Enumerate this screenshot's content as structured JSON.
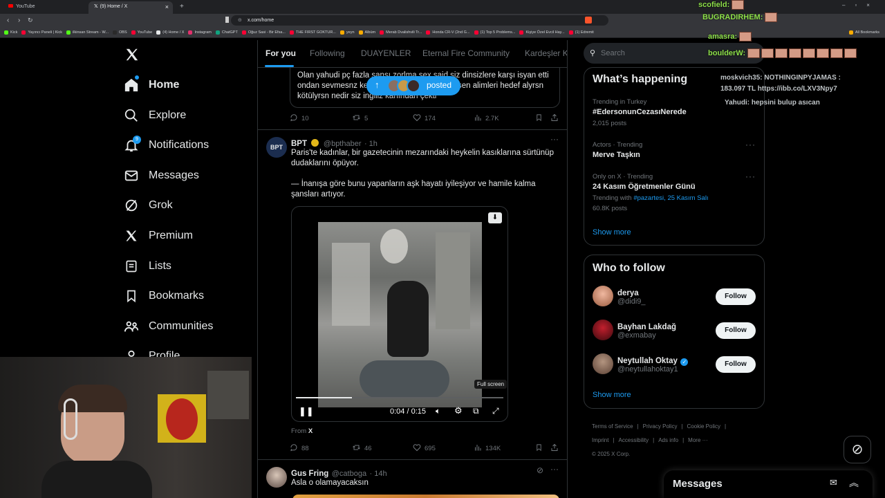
{
  "browser": {
    "tabs": [
      {
        "label": "YouTube"
      },
      {
        "label": "(9) Home / X"
      }
    ],
    "url": "x.com/home",
    "bookmarks": [
      "Kick",
      "Yayıncı Paneli | Kick",
      "ilkinsan Stream - W...",
      "OBS",
      "YouTube",
      "(4) Home / X",
      "Instagram",
      "ChatGPT",
      "Oğuz Sasi - Bir Efsa...",
      "THE FIRST GOKTUR...",
      "yeyn",
      "Albüm",
      "Merab Dvalishvili Tr...",
      "Honda CR-V (2nd G...",
      "(1) Top 5 Problems...",
      "Kişiye Özel Evcil Hay...",
      "(1) Edremit",
      "All Bookmarks"
    ]
  },
  "nav": {
    "items": [
      {
        "label": "Home",
        "icon": "home-icon"
      },
      {
        "label": "Explore",
        "icon": "search-icon"
      },
      {
        "label": "Notifications",
        "icon": "bell-icon",
        "badge": "9"
      },
      {
        "label": "Messages",
        "icon": "mail-icon"
      },
      {
        "label": "Grok",
        "icon": "grok-icon"
      },
      {
        "label": "Premium",
        "icon": "x-logo-icon"
      },
      {
        "label": "Lists",
        "icon": "list-icon"
      },
      {
        "label": "Bookmarks",
        "icon": "bookmark-icon"
      },
      {
        "label": "Communities",
        "icon": "people-icon"
      },
      {
        "label": "Profile",
        "icon": "person-icon"
      }
    ]
  },
  "feed": {
    "tabs": [
      "For you",
      "Following",
      "DUAYENLER",
      "Eternal Fire Community",
      "Kardeşler Ki"
    ],
    "posted_pill": "posted",
    "tweet1": {
      "text_lines": [
        "Olan yahudi pç fazla şansı zorlma sex said siz dinsizlere karşı isyan etti",
        "ondan sevmesnz ke",
        "sen alimleri hedef alyrsn",
        "kötülyrsn nedir siz ingiliz kanından çekti"
      ],
      "replies": "10",
      "reposts": "5",
      "likes": "174",
      "views": "2.7K"
    },
    "tweet2": {
      "avatar_text": "BPT",
      "name": "BPT",
      "handle": "@bpthaber",
      "time": "· 1h",
      "text1": "Paris'te kadınlar, bir gazetecinin mezarındaki heykelin kasıklarına sürtünüp dudaklarını öpüyor.",
      "text2": "— İnanışa göre bunu yapanların aşk hayatı iyileşiyor ve hamile kalma şansları artıyor.",
      "video_time": "0:04 / 0:15",
      "tooltip": "Full screen",
      "from_label": "From",
      "from_source": "X",
      "replies": "88",
      "reposts": "46",
      "likes": "695",
      "views": "134K",
      "video_progress": 0.27
    },
    "tweet3": {
      "name": "Gus Fring",
      "handle": "@catboga",
      "time": "· 14h",
      "text": "Asla o olamayacaksın"
    }
  },
  "sidebar": {
    "search_placeholder": "Search",
    "happening": {
      "title": "What’s happening",
      "trends": [
        {
          "meta": "Trending in Turkey",
          "name": "#EdersonunCezasıNerede",
          "count": "2,015 posts"
        },
        {
          "meta": "Actors · Trending",
          "name": "Merve Taşkın",
          "count": ""
        },
        {
          "meta": "Only on X · Trending",
          "name": "24 Kasım Öğretmenler Günü",
          "with_label": "Trending with",
          "with_tags": "#pazartesi, 25 Kasım Salı",
          "count": "60.8K posts"
        }
      ],
      "show_more": "Show more"
    },
    "who_to_follow": {
      "title": "Who to follow",
      "users": [
        {
          "name": "derya",
          "handle": "@didi9_",
          "button": "Follow",
          "verified": false
        },
        {
          "name": "Bayhan Lakdağ",
          "handle": "@exmabay",
          "button": "Follow",
          "verified": false
        },
        {
          "name": "Neytullah Oktay",
          "handle": "@neytullahoktay1",
          "button": "Follow",
          "verified": true
        }
      ],
      "show_more": "Show more"
    },
    "footer": {
      "links": [
        "Terms of Service",
        "Privacy Policy",
        "Cookie Policy",
        "Imprint",
        "Accessibility",
        "Ads info",
        "More ···"
      ],
      "copyright": "© 2025 X Corp."
    }
  },
  "messages_drawer": {
    "title": "Messages"
  },
  "stream_chat": {
    "lines": [
      {
        "name": "scofield:"
      },
      {
        "name": "BUGRADIRHEM:"
      },
      {
        "name": "amasra:"
      },
      {
        "name": "boulderW:"
      },
      {
        "text": "moskvich35: NOTHINGINPYJAMAS :"
      },
      {
        "text": "183.097 TL https://ibb.co/LXV3Npy7"
      },
      {
        "text": "Yahudi: hepsini bulup asıcan"
      }
    ]
  },
  "colors": {
    "accent": "#1d9bf0",
    "border": "#2f3336",
    "muted": "#71767b",
    "text": "#e7e9ea"
  }
}
